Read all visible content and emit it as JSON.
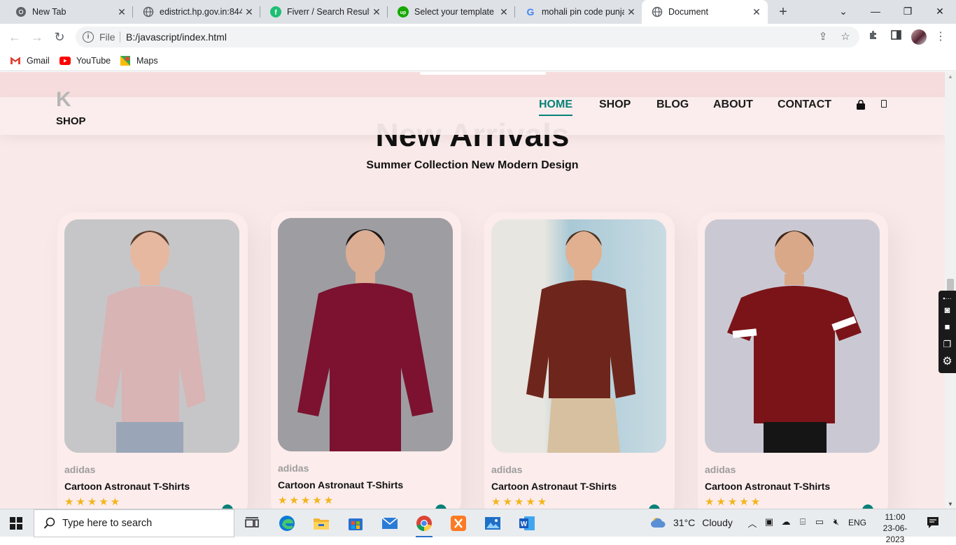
{
  "browser": {
    "tabs": [
      {
        "title": "New Tab",
        "icon": "chrome-icon"
      },
      {
        "title": "edistrict.hp.gov.in:844",
        "icon": "globe-icon"
      },
      {
        "title": "Fiverr / Search Results",
        "icon": "fiverr-icon"
      },
      {
        "title": "Select your template",
        "icon": "upwork-icon"
      },
      {
        "title": "mohali pin code punja",
        "icon": "google-icon"
      },
      {
        "title": "Document",
        "icon": "globe-icon"
      }
    ],
    "new_tab_symbol": "+",
    "window_buttons": {
      "dropdown": "⌄",
      "minimize": "—",
      "restore": "❐",
      "close": "✕"
    },
    "address": {
      "scheme_label": "File",
      "url": "B:/javascript/index.html"
    },
    "bookmarks": [
      "Gmail",
      "YouTube",
      "Maps"
    ]
  },
  "site": {
    "logo_letter": "K",
    "logo_text": "SHOP",
    "nav": [
      "HOME",
      "SHOP",
      "BLOG",
      "ABOUT",
      "CONTACT"
    ],
    "active_nav": "HOME",
    "accent_color": "#088178",
    "section_title": "New Arrivals",
    "section_subtitle": "Summer Collection New Modern Design",
    "products": [
      {
        "brand": "adidas",
        "name": "Cartoon Astronaut T-Shirts",
        "stars": "★★★★★",
        "rating": 5,
        "shirt_color": "#d8b4b4"
      },
      {
        "brand": "adidas",
        "name": "Cartoon Astronaut T-Shirts",
        "stars": "★★★★★",
        "rating": 5,
        "shirt_color": "#7c1230"
      },
      {
        "brand": "adidas",
        "name": "Cartoon Astronaut T-Shirts",
        "stars": "★★★★★",
        "rating": 5,
        "shirt_color": "#6e261c"
      },
      {
        "brand": "adidas",
        "name": "Cartoon Astronaut T-Shirts",
        "stars": "★★★★★",
        "rating": 5,
        "shirt_color": "#7b1419"
      }
    ]
  },
  "taskbar": {
    "search_placeholder": "Type here to search",
    "weather": {
      "temp": "31°C",
      "condition": "Cloudy"
    },
    "language": "ENG",
    "time": "11:00",
    "date": "23-06-2023"
  }
}
